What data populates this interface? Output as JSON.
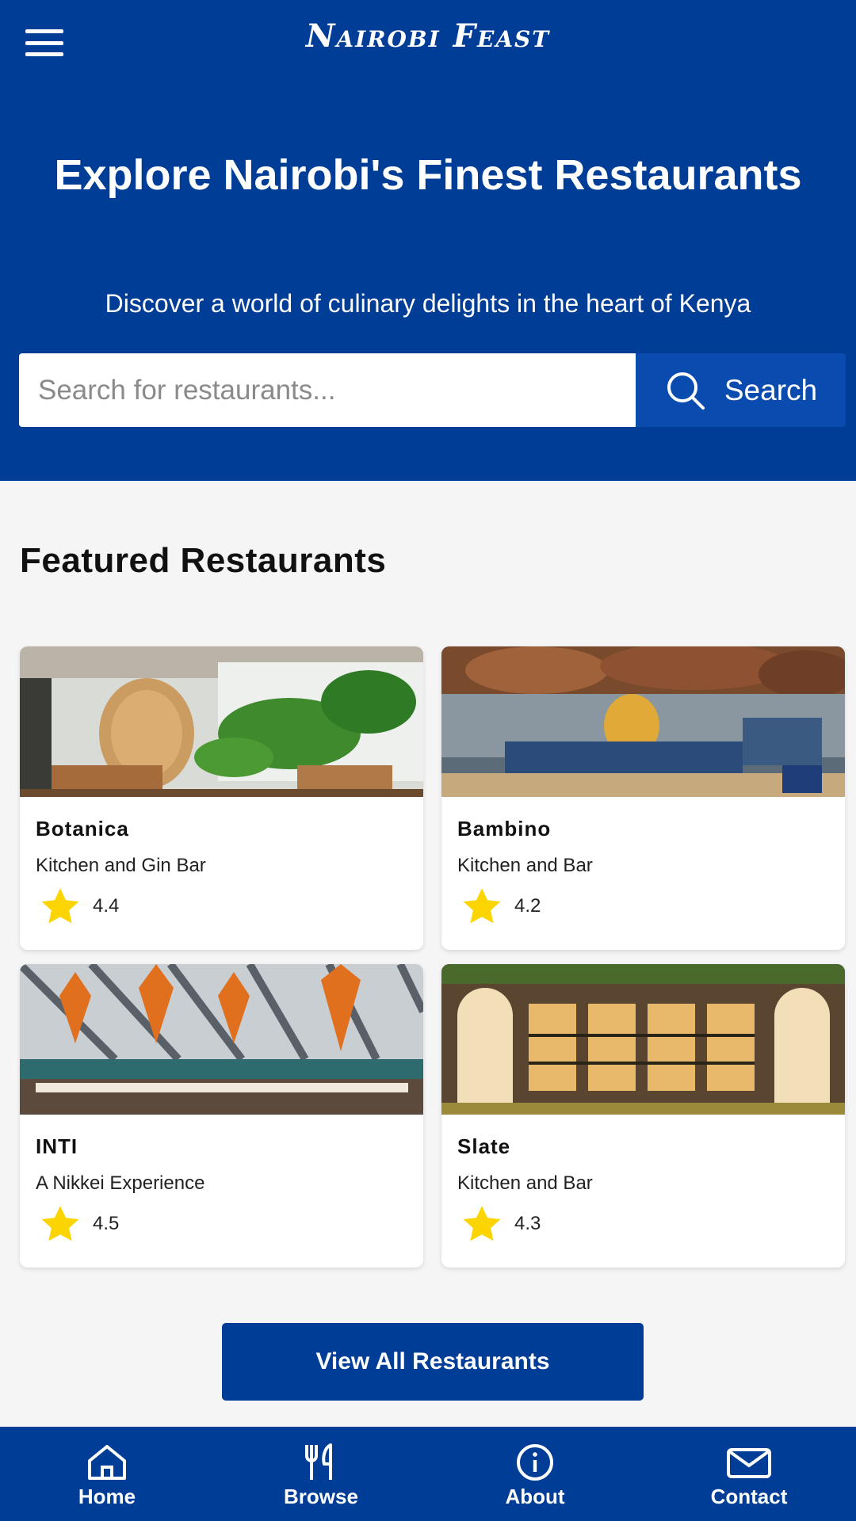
{
  "header": {
    "brand": "Nairobi Feast",
    "menu_icon": "hamburger-menu-icon"
  },
  "hero": {
    "title": "Explore Nairobi's Finest Restaurants",
    "subtitle": "Discover a world of culinary delights in the heart of Kenya"
  },
  "search": {
    "placeholder": "Search for restaurants...",
    "value": "",
    "button_label": "Search",
    "icon": "search-icon"
  },
  "featured": {
    "title": "Featured Restaurants",
    "restaurants": [
      {
        "name": "Botanica",
        "subtitle": "Kitchen and Gin Bar",
        "rating": "4.4"
      },
      {
        "name": "Bambino",
        "subtitle": "Kitchen and Bar",
        "rating": "4.2"
      },
      {
        "name": "INTI",
        "subtitle": "A Nikkei Experience",
        "rating": "4.5"
      },
      {
        "name": "Slate",
        "subtitle": "Kitchen and Bar",
        "rating": "4.3"
      }
    ]
  },
  "view_all_label": "View All Restaurants",
  "bottom_nav": {
    "items": [
      {
        "label": "Home",
        "icon": "home-icon"
      },
      {
        "label": "Browse",
        "icon": "utensils-icon"
      },
      {
        "label": "About",
        "icon": "info-icon"
      },
      {
        "label": "Contact",
        "icon": "mail-icon"
      }
    ]
  },
  "colors": {
    "primary": "#003d96",
    "search_button": "#0a4bb0",
    "star": "#fcd400",
    "background": "#f5f5f6"
  }
}
